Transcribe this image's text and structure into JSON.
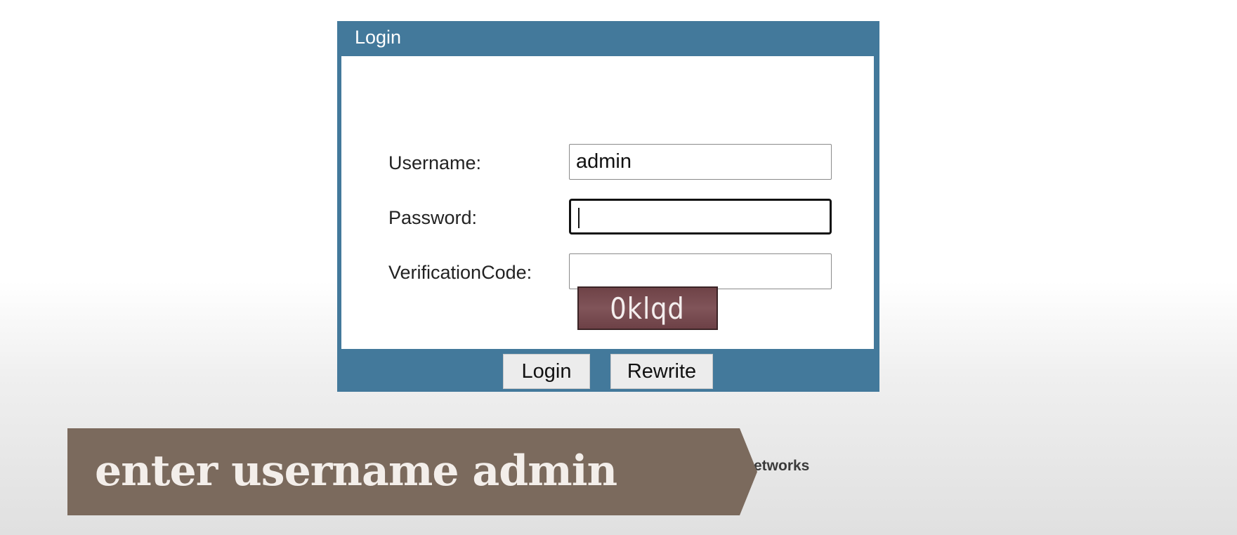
{
  "login_panel": {
    "title": "Login",
    "fields": {
      "username": {
        "label": "Username:",
        "value": "admin"
      },
      "password": {
        "label": "Password:",
        "value": ""
      },
      "verification": {
        "label": "VerificationCode:",
        "value": ""
      }
    },
    "captcha_text": "0klqd",
    "buttons": {
      "login": "Login",
      "rewrite": "Rewrite"
    },
    "colors": {
      "frame": "#43799b",
      "captcha_bg": "#7a4e53"
    }
  },
  "caption": {
    "text": "enter username admin",
    "bg_color": "#7b6a5d"
  },
  "background_brand_fragment": "etworks"
}
